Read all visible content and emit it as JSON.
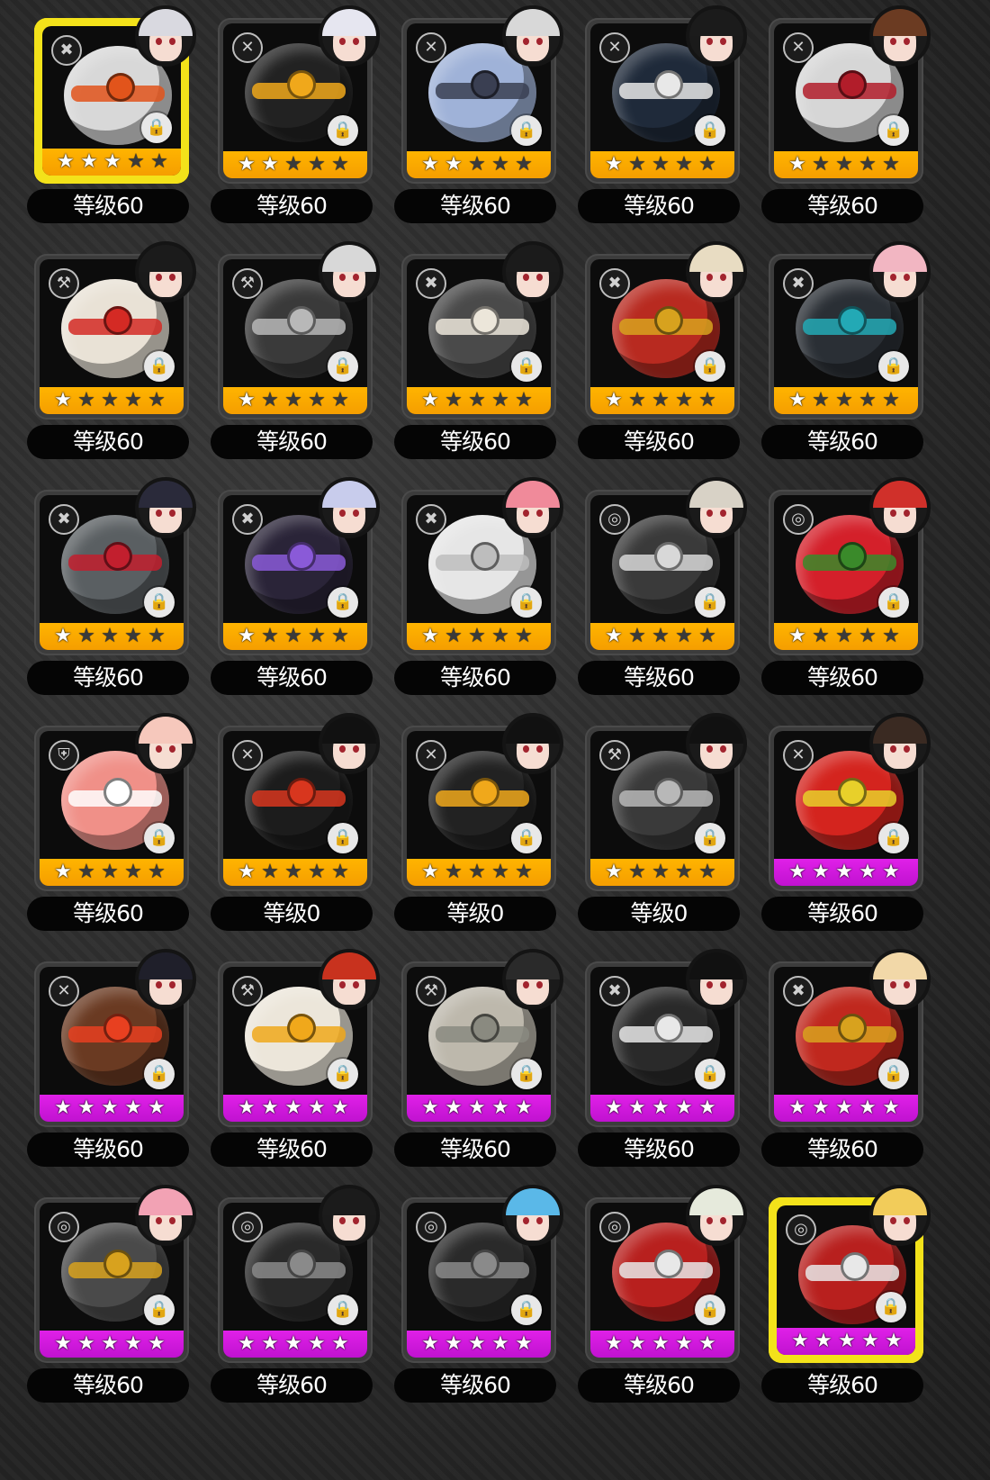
{
  "level_prefix": "等级",
  "colors": {
    "rarity_a": "#f59e00",
    "rarity_s": "#c012d0",
    "selected_border": "#f3e21a"
  },
  "bangboos": [
    {
      "level": "等级60",
      "stars": 3,
      "rarity": "A",
      "selected": true,
      "type_icon": "attack-icon",
      "core": "#d8d8d8",
      "band": "#e2541b",
      "hair": "#d9d9e0"
    },
    {
      "level": "等级60",
      "stars": 2,
      "rarity": "A",
      "selected": false,
      "type_icon": "stun-icon",
      "core": "#222222",
      "band": "#f0a81b",
      "hair": "#e6e6f0"
    },
    {
      "level": "等级60",
      "stars": 2,
      "rarity": "A",
      "selected": false,
      "type_icon": "stun-icon",
      "core": "#9fb2d8",
      "band": "#3a3f52",
      "hair": "#d8d8d8"
    },
    {
      "level": "等级60",
      "stars": 1,
      "rarity": "A",
      "selected": false,
      "type_icon": "stun-icon",
      "core": "#1f2a3a",
      "band": "#e8e8e8",
      "hair": "#1b1b1b"
    },
    {
      "level": "等级60",
      "stars": 1,
      "rarity": "A",
      "selected": false,
      "type_icon": "stun-icon",
      "core": "#d6d6d6",
      "band": "#b21d2a",
      "hair": "#6b3b22"
    },
    {
      "level": "等级60",
      "stars": 1,
      "rarity": "A",
      "selected": false,
      "type_icon": "support-icon",
      "core": "#e9e2d6",
      "band": "#d42a24",
      "hair": "#1b1b1b"
    },
    {
      "level": "等级60",
      "stars": 1,
      "rarity": "A",
      "selected": false,
      "type_icon": "support-icon",
      "core": "#3a3a3a",
      "band": "#b8b8b8",
      "hair": "#d8d8d8"
    },
    {
      "level": "等级60",
      "stars": 1,
      "rarity": "A",
      "selected": false,
      "type_icon": "attack-icon",
      "core": "#4a4a4a",
      "band": "#ece6da",
      "hair": "#1b1b1b"
    },
    {
      "level": "等级60",
      "stars": 1,
      "rarity": "A",
      "selected": false,
      "type_icon": "attack-icon",
      "core": "#b82a20",
      "band": "#d7a21e",
      "hair": "#e8dcc2"
    },
    {
      "level": "等级60",
      "stars": 1,
      "rarity": "A",
      "selected": false,
      "type_icon": "attack-icon",
      "core": "#2a2f35",
      "band": "#23a9b5",
      "hair": "#f2b6c2"
    },
    {
      "level": "等级60",
      "stars": 1,
      "rarity": "A",
      "selected": false,
      "type_icon": "attack-icon",
      "core": "#5a5f62",
      "band": "#c21f2e",
      "hair": "#2a2a3a"
    },
    {
      "level": "等级60",
      "stars": 1,
      "rarity": "A",
      "selected": false,
      "type_icon": "attack-icon",
      "core": "#2a2438",
      "band": "#8a5ad8",
      "hair": "#c8ccec"
    },
    {
      "level": "等级60",
      "stars": 1,
      "rarity": "A",
      "selected": false,
      "type_icon": "attack-icon",
      "core": "#e6e6e6",
      "band": "#bdbdbd",
      "hair": "#f08a9a"
    },
    {
      "level": "等级60",
      "stars": 1,
      "rarity": "A",
      "selected": false,
      "type_icon": "anomaly-icon",
      "core": "#3a3a3a",
      "band": "#d8d8d8",
      "hair": "#d8d2c6"
    },
    {
      "level": "等级60",
      "stars": 1,
      "rarity": "A",
      "selected": false,
      "type_icon": "anomaly-icon",
      "core": "#d4202a",
      "band": "#3a8a2a",
      "hair": "#d0302a"
    },
    {
      "level": "等级60",
      "stars": 1,
      "rarity": "A",
      "selected": false,
      "type_icon": "defense-icon",
      "core": "#f09088",
      "band": "#ffffff",
      "hair": "#f6c8bc"
    },
    {
      "level": "等级0",
      "stars": 1,
      "rarity": "A",
      "selected": false,
      "type_icon": "stun-icon",
      "core": "#1c1c1c",
      "band": "#d8361e",
      "hair": "#111111"
    },
    {
      "level": "等级0",
      "stars": 1,
      "rarity": "A",
      "selected": false,
      "type_icon": "stun-icon",
      "core": "#222222",
      "band": "#f0a81b",
      "hair": "#111111"
    },
    {
      "level": "等级0",
      "stars": 1,
      "rarity": "A",
      "selected": false,
      "type_icon": "support-icon",
      "core": "#3a3a3a",
      "band": "#b8b8b8",
      "hair": "#111111"
    },
    {
      "level": "等级60",
      "stars": 5,
      "rarity": "S",
      "selected": false,
      "type_icon": "stun-icon",
      "core": "#d4241e",
      "band": "#e8d02a",
      "hair": "#3a2a22"
    },
    {
      "level": "等级60",
      "stars": 5,
      "rarity": "S",
      "selected": false,
      "type_icon": "stun-icon",
      "core": "#6a3a22",
      "band": "#e84020",
      "hair": "#1f1f2a"
    },
    {
      "level": "等级60",
      "stars": 5,
      "rarity": "S",
      "selected": false,
      "type_icon": "support-icon",
      "core": "#ece6da",
      "band": "#f0a81b",
      "hair": "#c8321e"
    },
    {
      "level": "等级60",
      "stars": 5,
      "rarity": "S",
      "selected": false,
      "type_icon": "support-icon",
      "core": "#bdb8ac",
      "band": "#8a8a80",
      "hair": "#2a2a2a"
    },
    {
      "level": "等级60",
      "stars": 5,
      "rarity": "S",
      "selected": false,
      "type_icon": "attack-icon",
      "core": "#2a2a2a",
      "band": "#e8e8e8",
      "hair": "#111111"
    },
    {
      "level": "等级60",
      "stars": 5,
      "rarity": "S",
      "selected": false,
      "type_icon": "attack-icon",
      "core": "#c0281e",
      "band": "#d8a21e",
      "hair": "#f2d8a8"
    },
    {
      "level": "等级60",
      "stars": 5,
      "rarity": "S",
      "selected": false,
      "type_icon": "anomaly-icon",
      "core": "#4a4a4a",
      "band": "#d8a21e",
      "hair": "#f2a2b4"
    },
    {
      "level": "等级60",
      "stars": 5,
      "rarity": "S",
      "selected": false,
      "type_icon": "anomaly-icon",
      "core": "#2a2a2a",
      "band": "#8a8a8a",
      "hair": "#1b1b1b"
    },
    {
      "level": "等级60",
      "stars": 5,
      "rarity": "S",
      "selected": false,
      "type_icon": "anomaly-icon",
      "core": "#2a2a2a",
      "band": "#8a8a8a",
      "hair": "#5ab8e8"
    },
    {
      "level": "等级60",
      "stars": 5,
      "rarity": "S",
      "selected": false,
      "type_icon": "anomaly-icon",
      "core": "#b8201e",
      "band": "#e8e8e8",
      "hair": "#e6eadc"
    },
    {
      "level": "等级60",
      "stars": 5,
      "rarity": "S",
      "selected": true,
      "type_icon": "anomaly-icon",
      "core": "#b8201e",
      "band": "#e8e8e8",
      "hair": "#f2cc5a"
    }
  ]
}
